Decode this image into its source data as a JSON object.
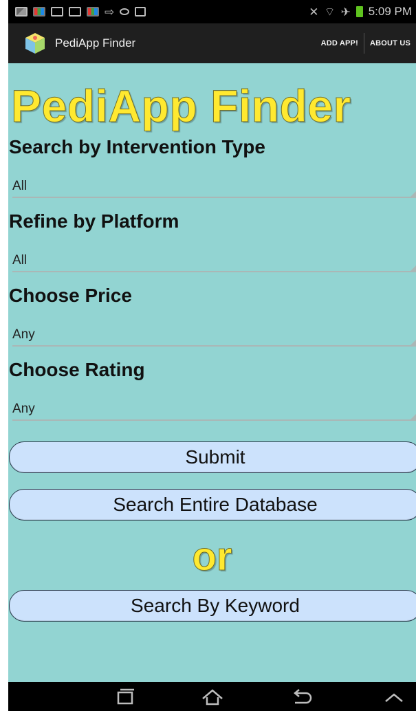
{
  "status_bar": {
    "time": "5:09 PM",
    "left_icons": [
      "gallery-icon",
      "photo-app-icon",
      "email-icon",
      "gmail-icon",
      "photo-app-icon",
      "transfer-icon",
      "sync-icon",
      "bag-icon"
    ],
    "right_icons": [
      "mute-icon",
      "wifi-icon",
      "airplane-icon",
      "battery-icon"
    ]
  },
  "action_bar": {
    "title": "PediApp Finder",
    "items": [
      {
        "label": "ADD APP!"
      },
      {
        "label": "ABOUT US"
      }
    ]
  },
  "main": {
    "hero_title": "PediApp Finder",
    "filters": [
      {
        "label": "Search by Intervention Type",
        "value": "All"
      },
      {
        "label": "Refine by Platform",
        "value": "All"
      },
      {
        "label": "Choose Price",
        "value": "Any"
      },
      {
        "label": "Choose Rating",
        "value": "Any"
      }
    ],
    "submit_label": "Submit",
    "search_all_label": "Search Entire Database",
    "or_label": "or",
    "keyword_label": "Search By Keyword"
  },
  "nav_bar": {
    "buttons": [
      "recent-apps-icon",
      "home-icon",
      "back-icon",
      "chevron-up-icon"
    ]
  },
  "colors": {
    "background": "#92d4d2",
    "title_yellow": "#ffe930",
    "button_fill": "#cce2fc",
    "action_bar": "#1f1f1f"
  }
}
